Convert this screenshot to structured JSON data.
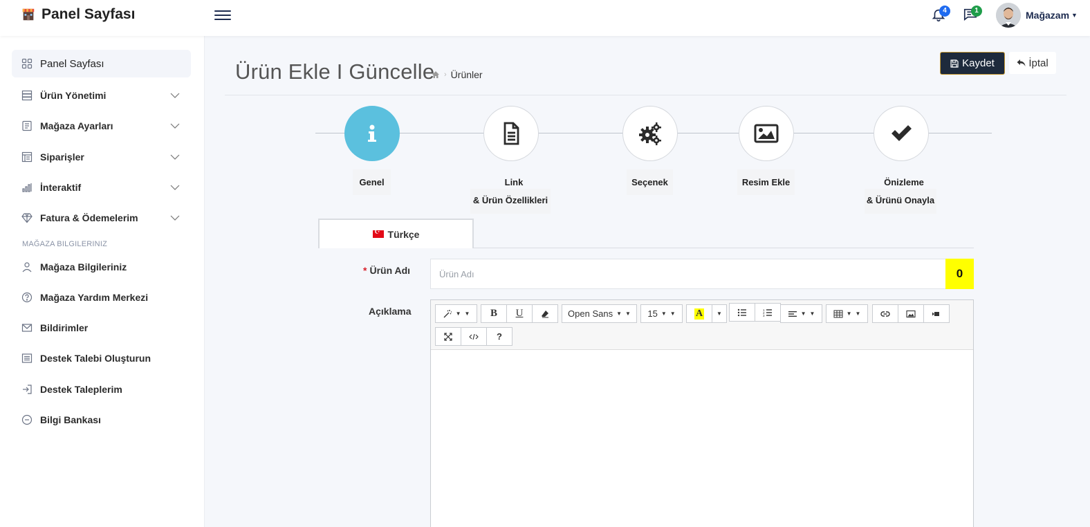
{
  "header": {
    "brand": "Panel Sayfası",
    "notifications_count": "4",
    "messages_count": "1",
    "user_name": "Mağazam"
  },
  "sidebar": {
    "items": [
      {
        "label": "Panel Sayfası",
        "icon": "grid-icon"
      },
      {
        "label": "Ürün Yönetimi",
        "icon": "server-icon"
      },
      {
        "label": "Mağaza Ayarları",
        "icon": "list-icon"
      },
      {
        "label": "Siparişler",
        "icon": "table-icon"
      },
      {
        "label": "İnteraktif",
        "icon": "bar-chart-icon"
      },
      {
        "label": "Fatura & Ödemelerim",
        "icon": "diamond-icon"
      }
    ],
    "section_title": "MAĞAZA BILGILERINIZ",
    "section_items": [
      {
        "label": "Mağaza Bilgileriniz",
        "icon": "user-icon"
      },
      {
        "label": "Mağaza Yardım Merkezi",
        "icon": "help-circle-icon"
      },
      {
        "label": "Bildirimler",
        "icon": "mail-icon"
      },
      {
        "label": "Destek Talebi Oluşturun",
        "icon": "document-list-icon"
      },
      {
        "label": "Destek Taleplerim",
        "icon": "login-icon"
      },
      {
        "label": "Bilgi Bankası",
        "icon": "minus-circle-icon"
      }
    ]
  },
  "main": {
    "title": "Ürün Ekle I Güncelle",
    "breadcrumb": "Ürünler",
    "save_label": "Kaydet",
    "cancel_label": "İptal"
  },
  "steps": [
    {
      "line1": "Genel",
      "line2": "",
      "icon": "info-icon"
    },
    {
      "line1": "Link",
      "line2": "& Ürün Özellikleri",
      "icon": "document-icon"
    },
    {
      "line1": "Seçenek",
      "line2": "",
      "icon": "gears-icon"
    },
    {
      "line1": "Resim Ekle",
      "line2": "",
      "icon": "image-icon"
    },
    {
      "line1": "Önizleme",
      "line2": "& Ürünü Onayla",
      "icon": "check-icon"
    }
  ],
  "tabs": [
    {
      "label": "Türkçe"
    }
  ],
  "form": {
    "name_label": "Ürün Adı",
    "name_placeholder": "Ürün Adı",
    "name_value": "",
    "char_count": "0",
    "description_label": "Açıklama"
  },
  "editor": {
    "font_family": "Open Sans",
    "font_size": "15",
    "help_label": "?"
  },
  "colors": {
    "accent": "#5bc0de",
    "save_button_bg": "#1e2a3c",
    "save_button_border": "#c79a33",
    "counter_bg": "#ffff00",
    "required": "#d9202b"
  }
}
